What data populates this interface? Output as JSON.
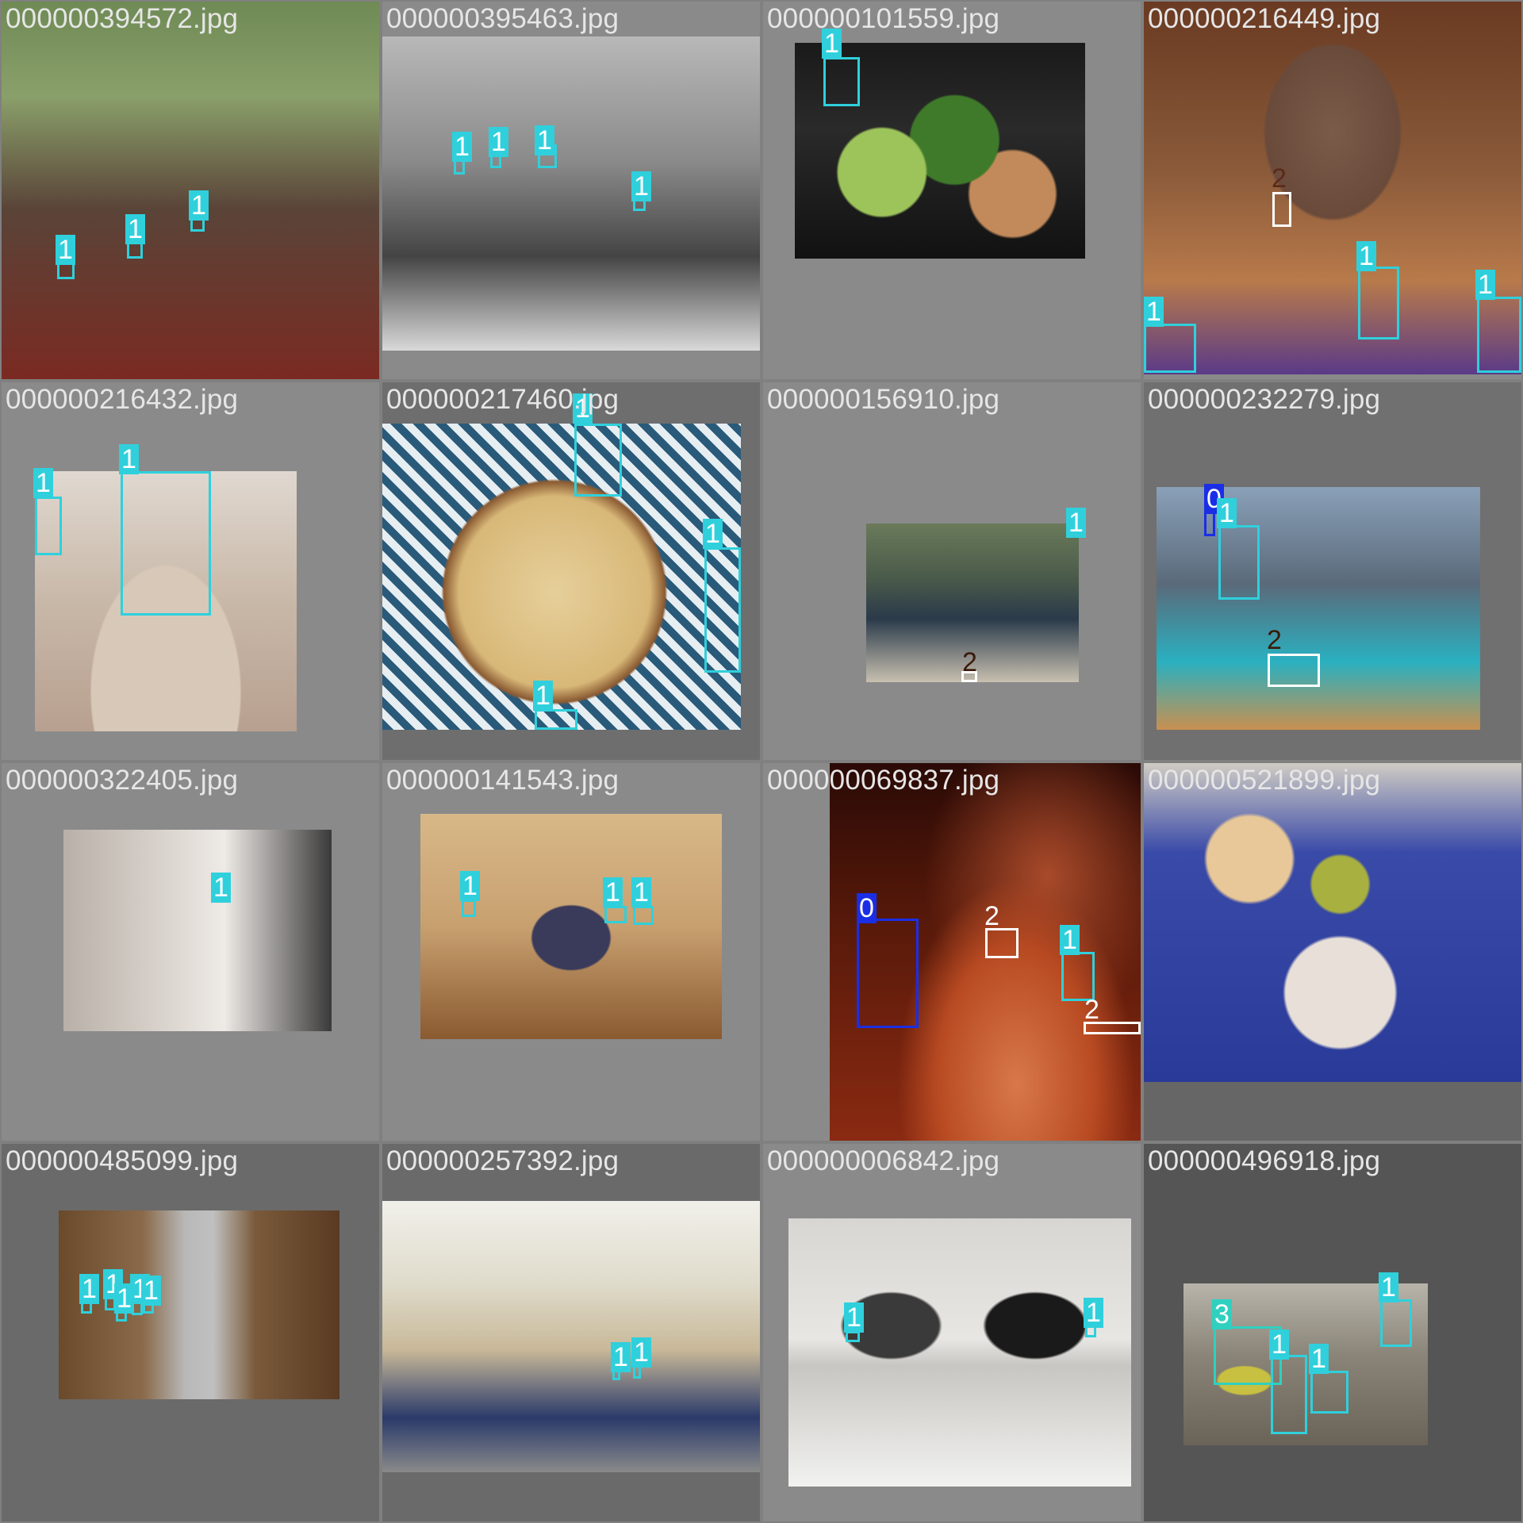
{
  "colors": {
    "class_0": "#1a2ee6",
    "class_1": "#2fd0dc",
    "class_2": "#ffffff",
    "class_3": "#2fd0c0",
    "filename_text": "#e6e6e6"
  },
  "tiles": [
    {
      "filename": "000000394572.jpg",
      "labels": [
        "1",
        "1",
        "1"
      ]
    },
    {
      "filename": "000000395463.jpg",
      "labels": [
        "1",
        "1",
        "1",
        "1"
      ]
    },
    {
      "filename": "000000101559.jpg",
      "labels": [
        "1"
      ]
    },
    {
      "filename": "000000216449.jpg",
      "labels": [
        "2",
        "1",
        "1",
        "1"
      ]
    },
    {
      "filename": "000000216432.jpg",
      "labels": [
        "1",
        "1"
      ]
    },
    {
      "filename": "000000217460.jpg",
      "labels": [
        "1",
        "1",
        "1"
      ]
    },
    {
      "filename": "000000156910.jpg",
      "labels": [
        "1",
        "2"
      ]
    },
    {
      "filename": "000000232279.jpg",
      "labels": [
        "0",
        "1",
        "2"
      ]
    },
    {
      "filename": "000000322405.jpg",
      "labels": [
        "1"
      ]
    },
    {
      "filename": "000000141543.jpg",
      "labels": [
        "1",
        "1",
        "1"
      ]
    },
    {
      "filename": "000000069837.jpg",
      "labels": [
        "0",
        "2",
        "1",
        "2"
      ]
    },
    {
      "filename": "000000521899.jpg",
      "labels": []
    },
    {
      "filename": "000000485099.jpg",
      "labels": [
        "1",
        "1",
        "1",
        "1",
        "1"
      ]
    },
    {
      "filename": "000000257392.jpg",
      "labels": [
        "1",
        "1"
      ]
    },
    {
      "filename": "000000006842.jpg",
      "labels": [
        "1",
        "1"
      ]
    },
    {
      "filename": "000000496918.jpg",
      "labels": [
        "3",
        "1",
        "1",
        "1"
      ]
    }
  ]
}
